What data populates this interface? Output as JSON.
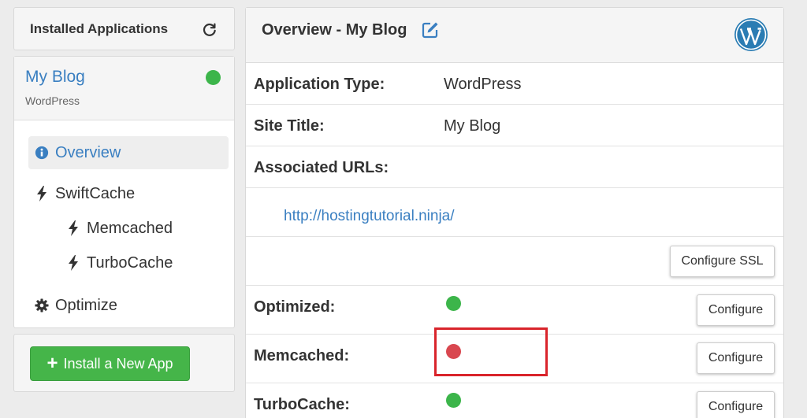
{
  "sidebar": {
    "header_title": "Installed Applications",
    "app": {
      "name": "My Blog",
      "type": "WordPress",
      "status": "active"
    },
    "nav": [
      {
        "label": "Overview",
        "icon": "info-circle-icon",
        "active": true
      },
      {
        "label": "SwiftCache",
        "icon": "bolt-icon"
      },
      {
        "label": "Memcached",
        "icon": "bolt-icon"
      },
      {
        "label": "TurboCache",
        "icon": "bolt-icon"
      },
      {
        "label": "Optimize",
        "icon": "gear-icon"
      }
    ],
    "install_button": "Install a New App"
  },
  "overview": {
    "title": "Overview - My Blog",
    "rows": {
      "app_type": {
        "label": "Application Type:",
        "value": "WordPress"
      },
      "site_title": {
        "label": "Site Title:",
        "value": "My Blog"
      },
      "urls": {
        "label": "Associated URLs:",
        "url": "http://hostingtutorial.ninja/"
      },
      "ssl": {
        "button": "Configure SSL"
      },
      "optimized": {
        "label": "Optimized:",
        "status": "green",
        "button": "Configure"
      },
      "memcached": {
        "label": "Memcached:",
        "status": "red",
        "button": "Configure"
      },
      "turbocache": {
        "label": "TurboCache:",
        "status": "green",
        "button": "Configure"
      }
    }
  },
  "colors": {
    "accent": "#3a7fc1",
    "success": "#45b549",
    "status_green": "#3cb54a",
    "status_red": "#d9474f",
    "highlight": "#d9242b"
  }
}
